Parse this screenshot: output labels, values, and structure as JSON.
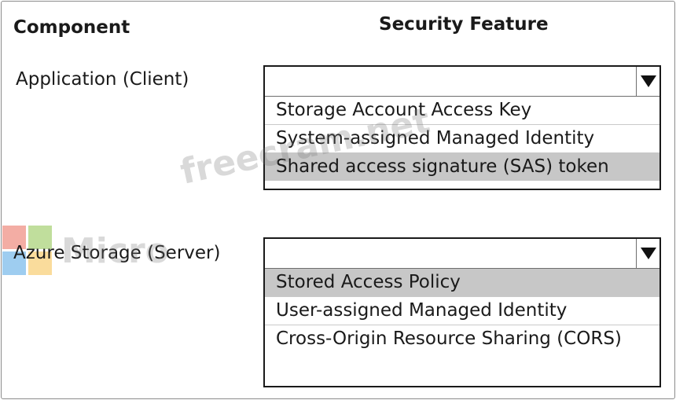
{
  "headers": {
    "component": "Component",
    "feature": "Security Feature"
  },
  "rows": [
    {
      "component": "Application (Client)",
      "options": [
        "Storage Account Access Key",
        "System-assigned Managed Identity",
        "Shared access signature (SAS) token"
      ],
      "selected_index": 2
    },
    {
      "component": "Azure Storage (Server)",
      "options": [
        "Stored Access Policy",
        "User-assigned Managed Identity",
        "Cross-Origin Resource Sharing (CORS)"
      ],
      "selected_index": 0
    }
  ],
  "watermark": {
    "left_text": "Micro",
    "right_text": "freecram.net"
  },
  "colors": {
    "selected_bg": "#c7c7c7",
    "border": "#1a1a1a"
  },
  "icons": {
    "dropdown": "triangle-down-icon",
    "logo": "microsoft-logo-icon"
  }
}
